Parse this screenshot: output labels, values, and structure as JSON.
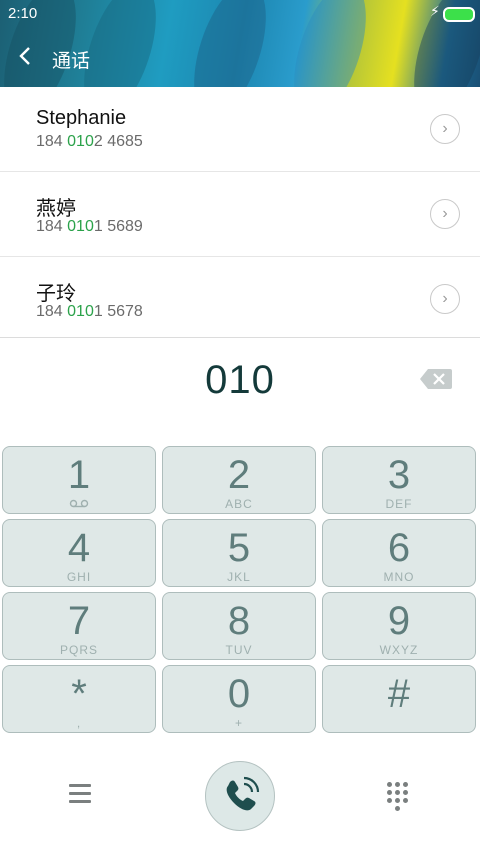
{
  "status_bar": {
    "time": "2:10"
  },
  "header": {
    "title": "通话"
  },
  "contacts": [
    {
      "name": "Stephanie",
      "number_prefix": "184 ",
      "number_match": "010",
      "number_suffix": "2 4685"
    },
    {
      "name": "燕婷",
      "number_prefix": "184 ",
      "number_match": "010",
      "number_suffix": "1 5689"
    },
    {
      "name": "子玲",
      "number_prefix": "184 ",
      "number_match": "010",
      "number_suffix": "1 5678"
    }
  ],
  "dialer": {
    "number": "010"
  },
  "keypad": [
    {
      "digit": "1",
      "letters": ""
    },
    {
      "digit": "2",
      "letters": "ABC"
    },
    {
      "digit": "3",
      "letters": "DEF"
    },
    {
      "digit": "4",
      "letters": "GHI"
    },
    {
      "digit": "5",
      "letters": "JKL"
    },
    {
      "digit": "6",
      "letters": "MNO"
    },
    {
      "digit": "7",
      "letters": "PQRS"
    },
    {
      "digit": "8",
      "letters": "TUV"
    },
    {
      "digit": "9",
      "letters": "WXYZ"
    },
    {
      "digit": "*",
      "letters": ","
    },
    {
      "digit": "0",
      "letters": "+"
    },
    {
      "digit": "#",
      "letters": ""
    }
  ],
  "colors": {
    "accent_green": "#2ba24a",
    "key_bg": "#dfe8e7",
    "key_text": "#5f7d7c"
  }
}
